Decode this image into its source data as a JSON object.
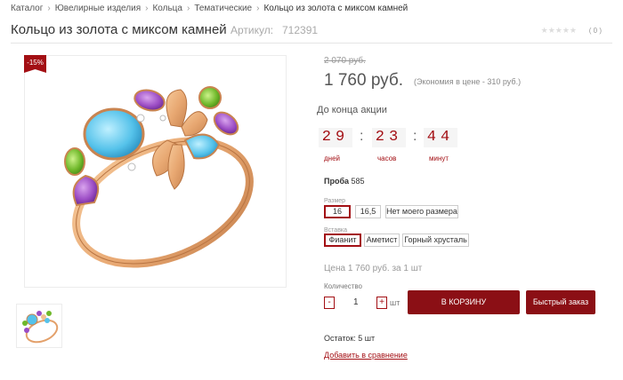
{
  "breadcrumb": {
    "items": [
      "Каталог",
      "Ювелирные изделия",
      "Кольца",
      "Тематические",
      "Кольцо из золота с миксом камней"
    ],
    "separator": "›"
  },
  "product": {
    "title": "Кольцо из золота с миксом камней",
    "article_label": "Артикул:",
    "article_value": "712391",
    "rating_stars": "★★★★★",
    "rating_count": "( 0 )",
    "discount_badge": "-15%",
    "old_price": "2 070 руб.",
    "price": "1 760 руб.",
    "savings": "(Экономия в цене - 310 руб.)"
  },
  "promo": {
    "label": "До конца акции",
    "days": "29",
    "hours": "23",
    "minutes": "44",
    "colon": ":",
    "days_label": "дней",
    "hours_label": "часов",
    "minutes_label": "минут"
  },
  "specs": {
    "proba_label": "Проба",
    "proba_value": "585"
  },
  "size": {
    "label": "Размер",
    "options": [
      "16",
      "16,5",
      "Нет моего размера"
    ],
    "selected": "16"
  },
  "insert": {
    "label": "Вставка",
    "options": [
      "Фианит",
      "Аметист",
      "Горный хрусталь"
    ],
    "selected": "Фианит"
  },
  "purchase": {
    "unit_price": "Цена 1 760 руб. за 1 шт",
    "qty_label": "Количество",
    "minus": "-",
    "plus": "+",
    "qty_value": "1",
    "qty_unit": "шт",
    "cart_button": "В КОРЗИНУ",
    "quick_button": "Быстрый заказ",
    "stock": "Остаток: 5 шт",
    "compare_link": "Добавить в сравнение"
  },
  "colors": {
    "accent": "#a30f14",
    "button": "#8b0f15"
  }
}
